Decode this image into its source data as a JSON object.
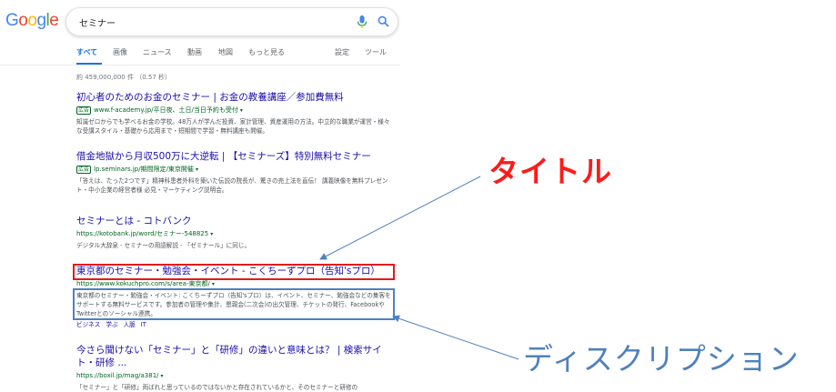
{
  "logo": {
    "text": "Google"
  },
  "search": {
    "query": "セミナー"
  },
  "tabs": [
    {
      "label": "すべて"
    },
    {
      "label": "画像"
    },
    {
      "label": "ニュース"
    },
    {
      "label": "動画"
    },
    {
      "label": "地図"
    },
    {
      "label": "もっと見る"
    },
    {
      "label": "設定"
    },
    {
      "label": "ツール"
    }
  ],
  "stats": "約 459,000,000 件 （0.57 秒）",
  "results": [
    {
      "title": "初心者のためのお金のセミナー | お金の教養講座／参加費無料",
      "ad": "広告",
      "url": "www.f-academy.jp/平日夜、土日/当日予約も受付",
      "desc": "知識ゼロからでも学べるお金の学校。48万人が学んだ投資、家計管理、資産運用の方法。中立的な職業が運営・様々な受講スタイル・基礎から応用まで・短期間で学習・無料講座も開催。"
    },
    {
      "title": "借金地獄から月収500万に大逆転 | 【セミナーズ】特別無料セミナー",
      "ad": "広告",
      "url": "lp.seminars.jp/期間限定/東京開催",
      "desc": "「答えは、たった2つです」精神科患者外科を築いた伝説の院長が、驚きの売上法を直伝！ 講義映像を無料プレゼント・中小企業の経営者様 必見・マーケティング説明会。"
    },
    {
      "title": "セミナーとは - コトバンク",
      "url": "https://kotobank.jp/word/セミナー-548825",
      "desc": "デジタル大辞泉 - セミナーの用語解説 - 「ゼミナール」に同じ。"
    },
    {
      "title": "東京都のセミナー・勉強会・イベント - こくちーずプロ（告知'sプロ）",
      "url": "https://www.kokuchpro.com/s/area-東京都/",
      "desc": "東京都のセミナー・勉強会・イベント: こくちーずプロ（告知'sプロ）は、イベント、セミナー、勉強会などの集客をサポートする無料サービスです。参加者の管理や集計、懇親会(二次会)の出欠管理、チケットの発行、FacebookやTwitterとのソーシャル連携。",
      "sitelinks": [
        "ビジネス",
        "学ぶ",
        "人脈",
        "IT"
      ]
    },
    {
      "title": "今さら聞けない「セミナー」と「研修」の違いと意味とは？ | 検索サイト・研修 ...",
      "url": "https://boxil.jp/mag/a381/",
      "desc": "「セミナー」と「研修」両ばれと思っているのではないかと存在されているかと、そのセミナーと研修の"
    }
  ],
  "annotations": {
    "title_label": "タイトル",
    "desc_label": "ディスクリプション",
    "title_color": "#ff1a1a",
    "desc_color": "#4f81bd"
  }
}
